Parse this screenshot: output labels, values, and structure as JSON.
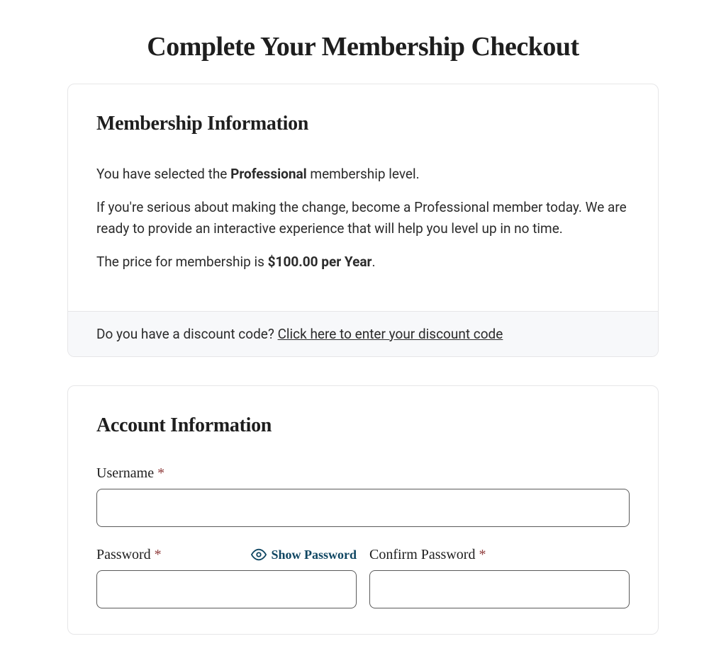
{
  "page": {
    "title": "Complete Your Membership Checkout"
  },
  "membership": {
    "heading": "Membership Information",
    "selected_prefix": "You have selected the ",
    "selected_level": "Professional",
    "selected_suffix": " membership level.",
    "description": "If you're serious about making the change, become a Professional member today. We are ready to provide an interactive experience that will help you level up in no time.",
    "price_prefix": "The price for membership is ",
    "price_value": "$100.00 per Year",
    "price_suffix": ".",
    "discount_prompt": "Do you have a discount code? ",
    "discount_link": "Click here to enter your discount code"
  },
  "account": {
    "heading": "Account Information",
    "username_label": "Username",
    "password_label": "Password",
    "confirm_password_label": "Confirm Password",
    "show_password_label": "Show Password",
    "required_mark": "*"
  }
}
